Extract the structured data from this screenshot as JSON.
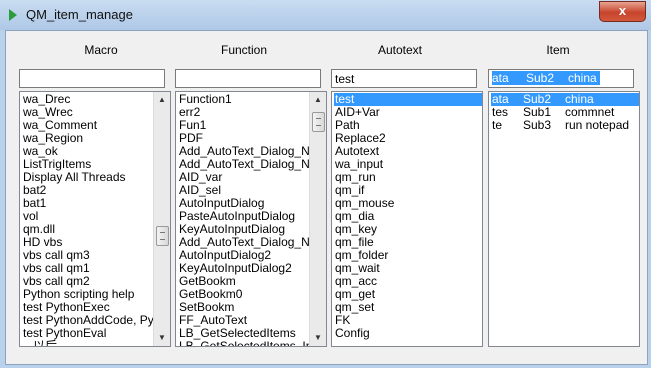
{
  "window": {
    "title": "QM_item_manage",
    "close_label": "x"
  },
  "macro": {
    "header": "Macro",
    "input_value": "",
    "items": [
      "wa_Drec",
      "wa_Wrec",
      "wa_Comment",
      "wa_Region",
      "wa_ok",
      "ListTrigItems",
      "Display All Threads",
      "bat2",
      "bat1",
      "vol",
      "qm.dll",
      "HD vbs",
      "vbs call qm3",
      "vbs call qm1",
      "vbs call qm2",
      "Python scripting help",
      "test PythonExec",
      "test PythonAddCode, Pyth",
      "test PythonEval",
      "...以后..."
    ]
  },
  "function": {
    "header": "Function",
    "input_value": "",
    "items": [
      "Function1",
      "err2",
      "Fun1",
      "PDF",
      "Add_AutoText_Dialog_Ne",
      "Add_AutoText_Dialog_Ne",
      "AID_var",
      "AID_sel",
      "AutoInputDialog",
      "PasteAutoInputDialog",
      "KeyAutoInputDialog",
      "Add_AutoText_Dialog_Ne",
      "AutoInputDialog2",
      "KeyAutoInputDialog2",
      "GetBookm",
      "GetBookm0",
      "SetBookm",
      "FF_AutoText",
      "LB_GetSelectedItems",
      "LB_GetSelectedItems_Ind"
    ]
  },
  "autotext": {
    "header": "Autotext",
    "input_value": "test",
    "selected_index": 0,
    "items": [
      "test",
      "AID+Var",
      "Path",
      "Replace2",
      "Autotext",
      "wa_input",
      "qm_run",
      "qm_if",
      "qm_mouse",
      "qm_dia",
      "qm_key",
      "qm_file",
      "qm_folder",
      "qm_wait",
      "qm_acc",
      "qm_get",
      "qm_set",
      "FK",
      "Config"
    ]
  },
  "item": {
    "header": "Item",
    "input": {
      "c1": "ata",
      "c2": "Sub2",
      "c3": "china"
    },
    "selected_index": 0,
    "rows": [
      {
        "c1": "ata",
        "c2": "Sub2",
        "c3": "china"
      },
      {
        "c1": "tes",
        "c2": "Sub1",
        "c3": "commnet"
      },
      {
        "c1": "te",
        "c2": "Sub3",
        "c3": "run notepad"
      }
    ]
  }
}
